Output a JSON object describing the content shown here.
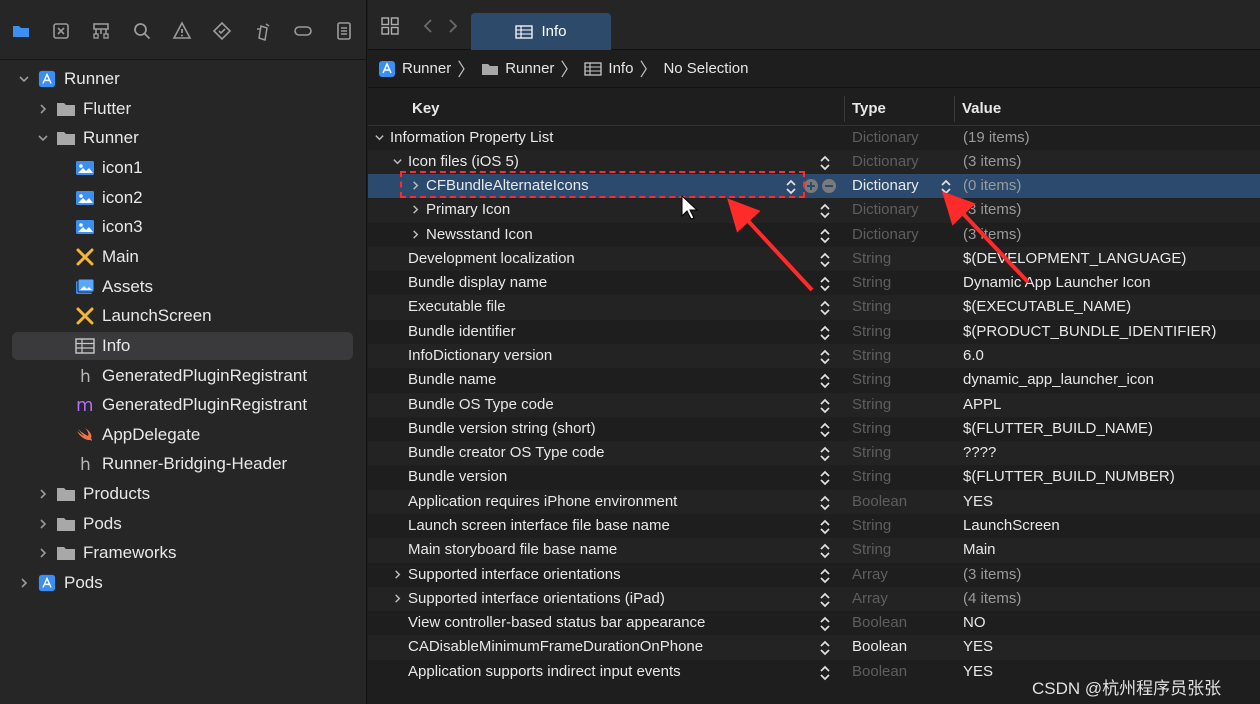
{
  "navigator": {
    "toolbar_icons": [
      "folder-icon",
      "source-control-icon",
      "hierarchy-icon",
      "search-icon",
      "warning-icon",
      "test-icon",
      "debug-icon",
      "breakpoint-icon",
      "report-icon"
    ],
    "tree": [
      {
        "label": "Runner",
        "icon": "project-icon",
        "expanded": true
      },
      {
        "label": "Flutter",
        "icon": "folder-icon",
        "expanded": false
      },
      {
        "label": "Runner",
        "icon": "folder-icon",
        "expanded": true
      },
      {
        "label": "icon1",
        "icon": "image-icon"
      },
      {
        "label": "icon2",
        "icon": "image-icon"
      },
      {
        "label": "icon3",
        "icon": "image-icon"
      },
      {
        "label": "Main",
        "icon": "storyboard-icon"
      },
      {
        "label": "Assets",
        "icon": "asset-catalog-icon"
      },
      {
        "label": "LaunchScreen",
        "icon": "storyboard-icon"
      },
      {
        "label": "Info",
        "icon": "plist-icon",
        "selected": true
      },
      {
        "label": "GeneratedPluginRegistrant",
        "icon": "header-h-icon"
      },
      {
        "label": "GeneratedPluginRegistrant",
        "icon": "source-m-icon"
      },
      {
        "label": "AppDelegate",
        "icon": "swift-icon"
      },
      {
        "label": "Runner-Bridging-Header",
        "icon": "header-h-icon"
      },
      {
        "label": "Products",
        "icon": "folder-icon",
        "expanded": false
      },
      {
        "label": "Pods",
        "icon": "folder-icon",
        "expanded": false
      },
      {
        "label": "Frameworks",
        "icon": "folder-icon",
        "expanded": false
      },
      {
        "label": "Pods",
        "icon": "project-icon",
        "expanded": false
      }
    ]
  },
  "editor": {
    "tab_label": "Info",
    "breadcrumb": [
      "Runner",
      "Runner",
      "Info",
      "No Selection"
    ],
    "columns": {
      "key": "Key",
      "type": "Type",
      "value": "Value"
    },
    "rows": [
      {
        "key": "Information Property List",
        "type": "Dictionary",
        "value": "(19 items)"
      },
      {
        "key": "Icon files (iOS 5)",
        "type": "Dictionary",
        "value": "(3 items)"
      },
      {
        "key": "CFBundleAlternateIcons",
        "type": "Dictionary",
        "value": "(0 items)"
      },
      {
        "key": "Primary Icon",
        "type": "Dictionary",
        "value": "(3 items)"
      },
      {
        "key": "Newsstand Icon",
        "type": "Dictionary",
        "value": "(3 items)"
      },
      {
        "key": "Development localization",
        "type": "String",
        "value": "$(DEVELOPMENT_LANGUAGE)"
      },
      {
        "key": "Bundle display name",
        "type": "String",
        "value": "Dynamic App Launcher Icon"
      },
      {
        "key": "Executable file",
        "type": "String",
        "value": "$(EXECUTABLE_NAME)"
      },
      {
        "key": "Bundle identifier",
        "type": "String",
        "value": "$(PRODUCT_BUNDLE_IDENTIFIER)"
      },
      {
        "key": "InfoDictionary version",
        "type": "String",
        "value": "6.0"
      },
      {
        "key": "Bundle name",
        "type": "String",
        "value": "dynamic_app_launcher_icon"
      },
      {
        "key": "Bundle OS Type code",
        "type": "String",
        "value": "APPL"
      },
      {
        "key": "Bundle version string (short)",
        "type": "String",
        "value": "$(FLUTTER_BUILD_NAME)"
      },
      {
        "key": "Bundle creator OS Type code",
        "type": "String",
        "value": "????"
      },
      {
        "key": "Bundle version",
        "type": "String",
        "value": "$(FLUTTER_BUILD_NUMBER)"
      },
      {
        "key": "Application requires iPhone environment",
        "type": "Boolean",
        "value": "YES"
      },
      {
        "key": "Launch screen interface file base name",
        "type": "String",
        "value": "LaunchScreen"
      },
      {
        "key": "Main storyboard file base name",
        "type": "String",
        "value": "Main"
      },
      {
        "key": "Supported interface orientations",
        "type": "Array",
        "value": "(3 items)"
      },
      {
        "key": "Supported interface orientations (iPad)",
        "type": "Array",
        "value": "(4 items)"
      },
      {
        "key": "View controller-based status bar appearance",
        "type": "Boolean",
        "value": "NO"
      },
      {
        "key": "CADisableMinimumFrameDurationOnPhone",
        "type": "Boolean",
        "value": "YES"
      },
      {
        "key": "Application supports indirect input events",
        "type": "Boolean",
        "value": "YES"
      }
    ]
  },
  "watermark": "CSDN @杭州程序员张张",
  "colors": {
    "accent": "#2c4a6e",
    "tab_active": "#2e4a6b",
    "annotation": "#ff2a2a",
    "swift": "#f0734a",
    "storyboard": "#f5b731",
    "image": "#3b8ff0"
  }
}
